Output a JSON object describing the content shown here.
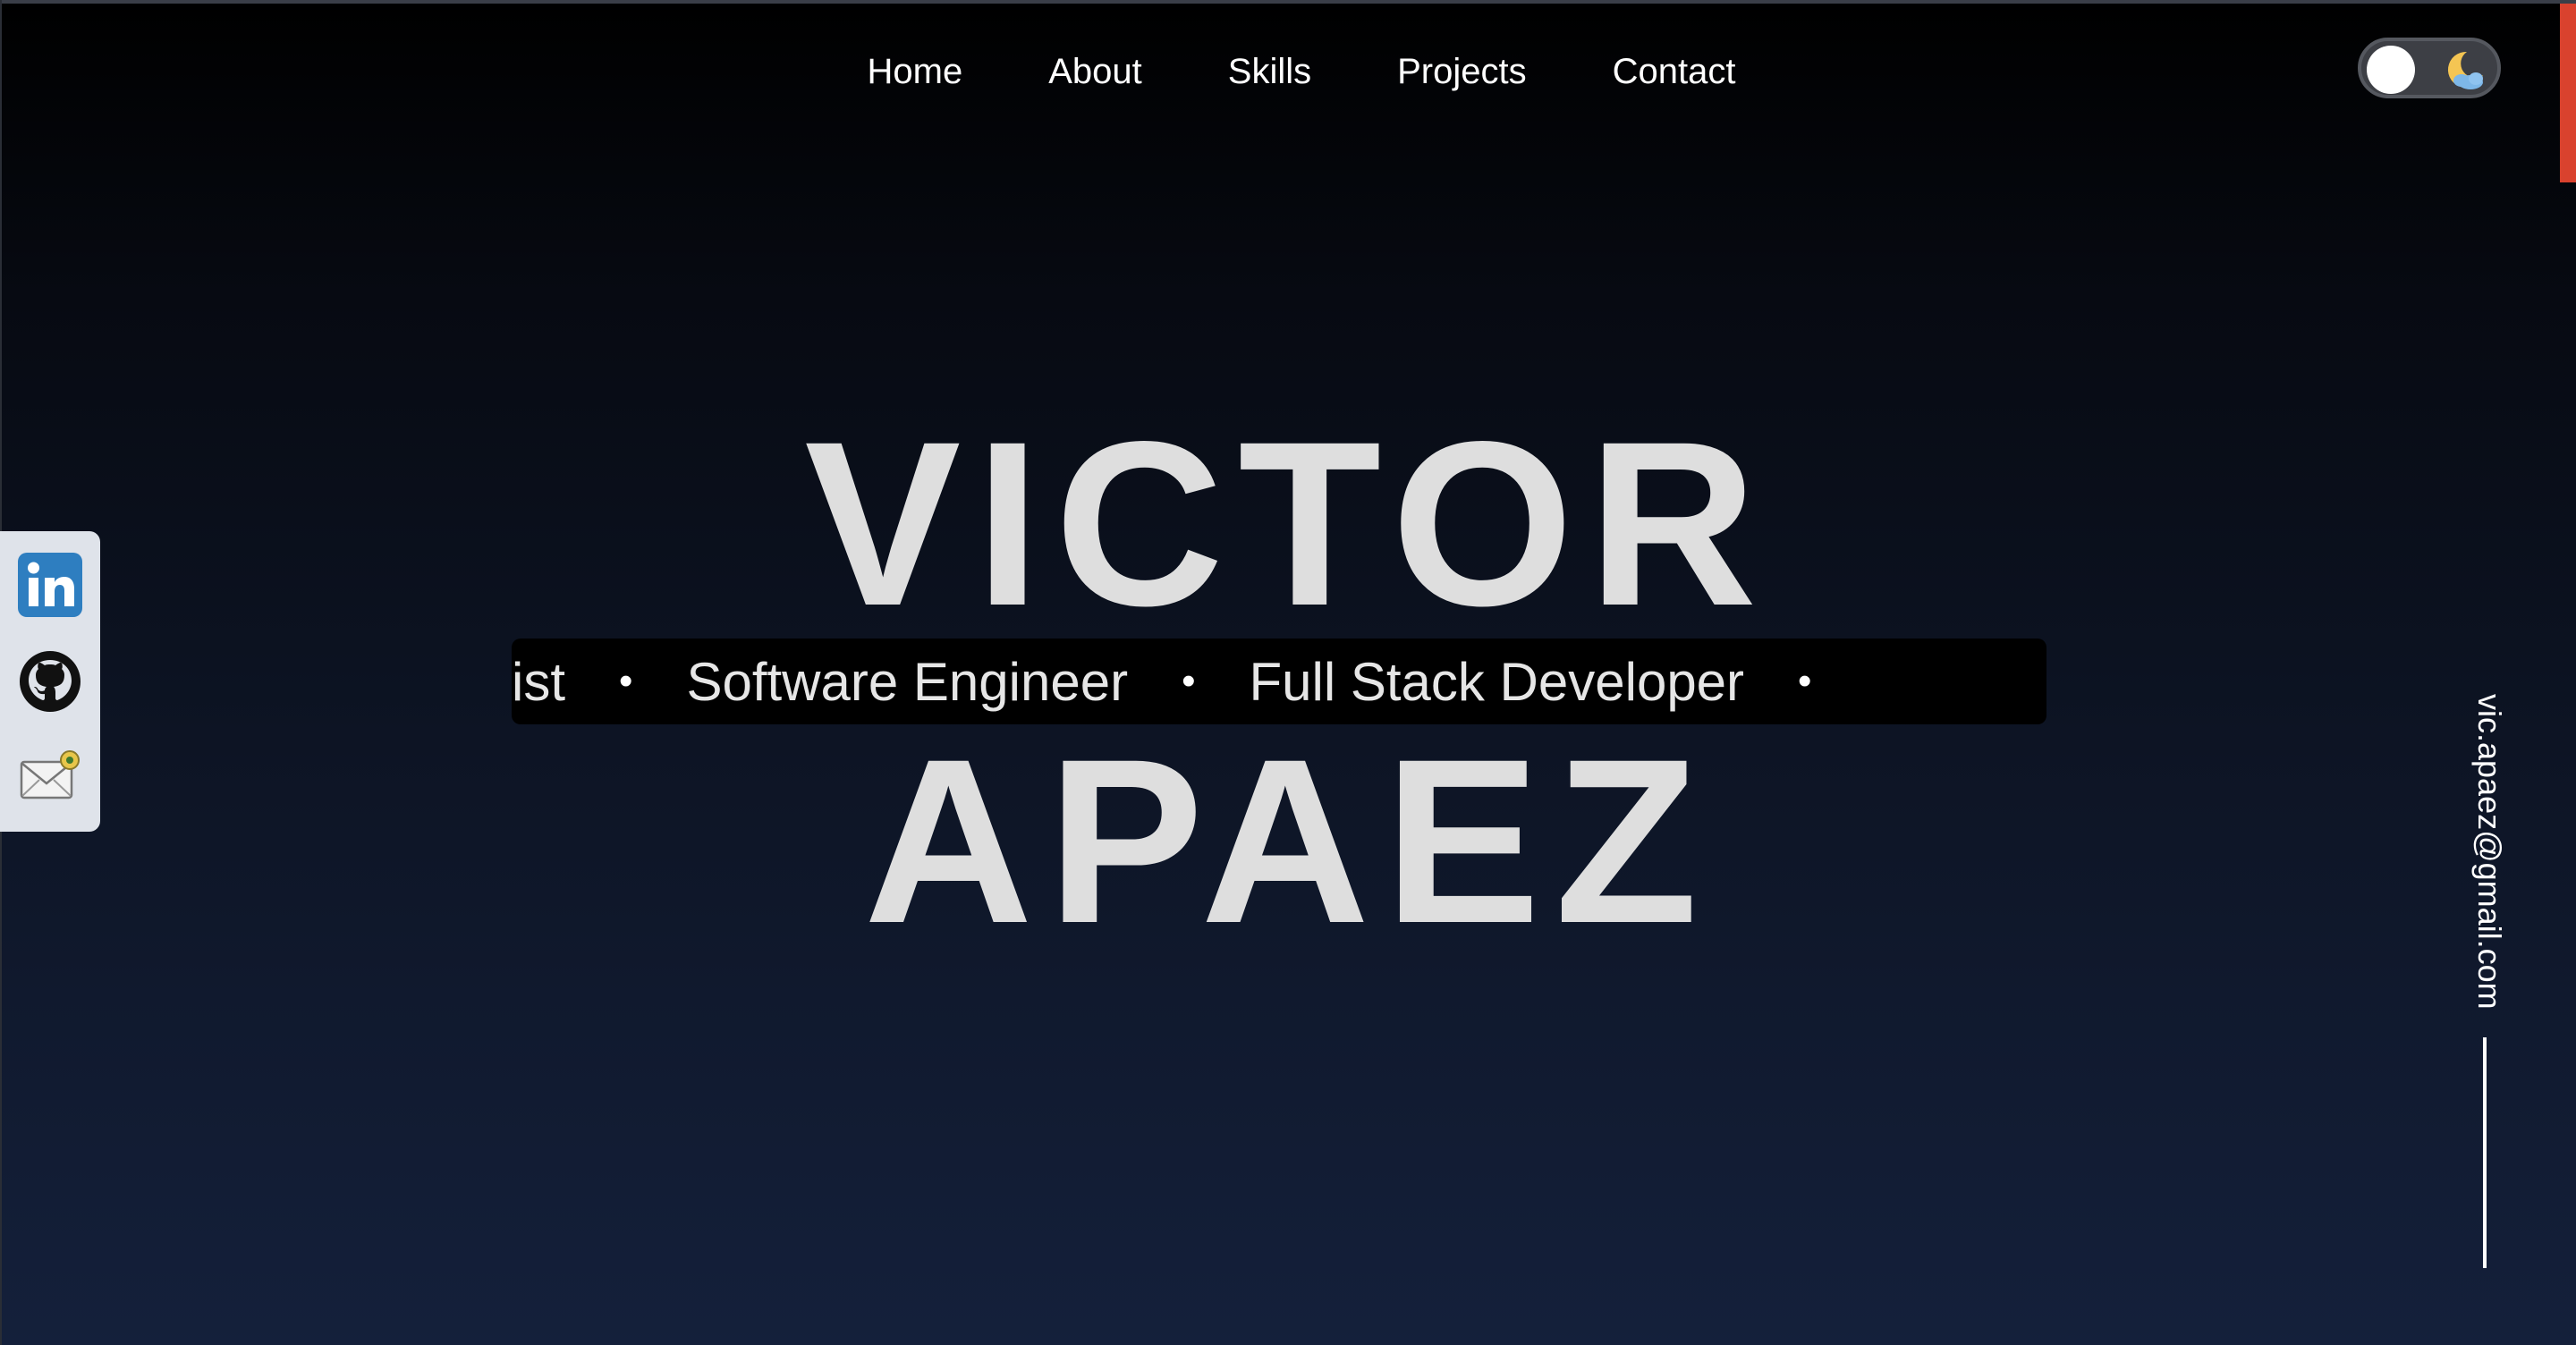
{
  "nav": {
    "items": [
      {
        "label": "Home"
      },
      {
        "label": "About"
      },
      {
        "label": "Skills"
      },
      {
        "label": "Projects"
      },
      {
        "label": "Contact"
      }
    ]
  },
  "theme_toggle": {
    "state": "dark",
    "icon": "moon-cloud-icon"
  },
  "hero": {
    "first_name": "VICTOR",
    "last_name": "APAEZ"
  },
  "marquee": {
    "items": [
      "cialist",
      "Software Engineer",
      "Full Stack Developer"
    ],
    "separator": "•"
  },
  "social": {
    "items": [
      {
        "icon": "linkedin-icon"
      },
      {
        "icon": "github-icon"
      },
      {
        "icon": "email-icon"
      }
    ]
  },
  "side_email": {
    "address": "vic.apaez@gmail.com"
  },
  "colors": {
    "accent": "#d9422e",
    "name_text": "#dedede",
    "background_top": "#000000",
    "background_bottom": "#14203b",
    "linkedin": "#2e7ec0"
  }
}
